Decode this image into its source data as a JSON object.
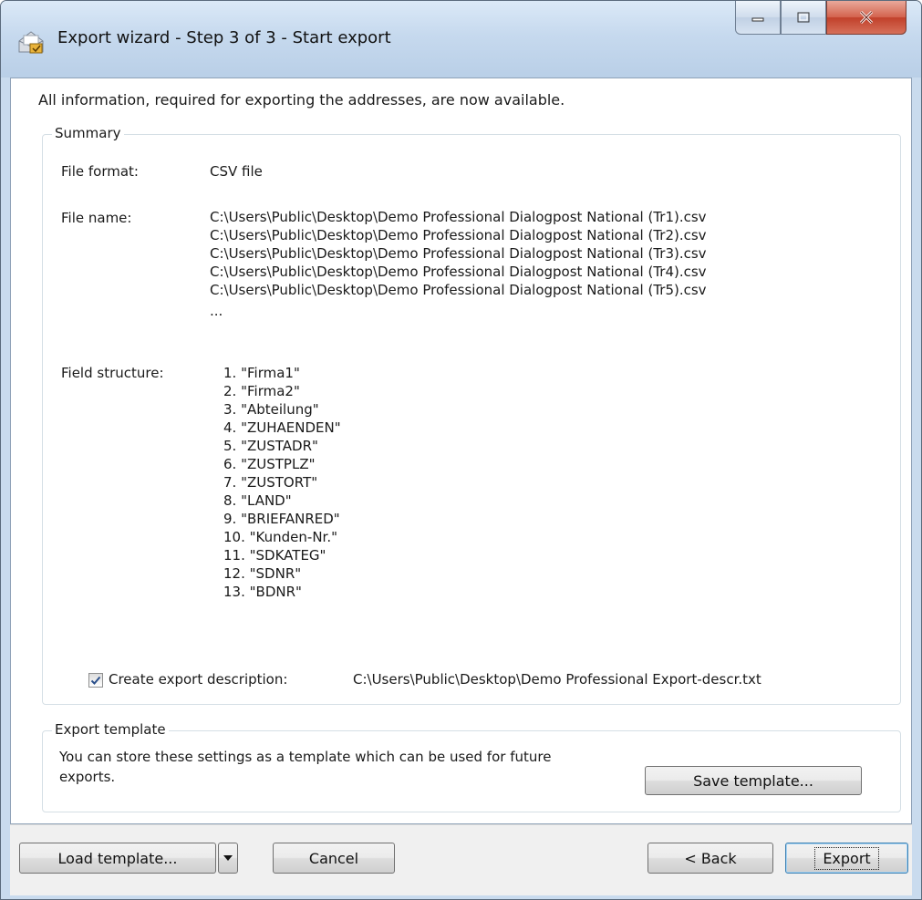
{
  "window": {
    "title": "Export wizard - Step 3 of 3 - Start export"
  },
  "intro_text": "All information, required for exporting the addresses, are now available.",
  "summary": {
    "legend": "Summary",
    "file_format_label": "File format:",
    "file_format_value": "CSV file",
    "file_name_label": "File name:",
    "file_names": [
      "C:\\Users\\Public\\Desktop\\Demo Professional Dialogpost National (Tr1).csv",
      "C:\\Users\\Public\\Desktop\\Demo Professional Dialogpost National (Tr2).csv",
      "C:\\Users\\Public\\Desktop\\Demo Professional Dialogpost National (Tr3).csv",
      "C:\\Users\\Public\\Desktop\\Demo Professional Dialogpost National (Tr4).csv",
      "C:\\Users\\Public\\Desktop\\Demo Professional Dialogpost National (Tr5).csv"
    ],
    "file_names_more": "...",
    "field_structure_label": "Field structure:",
    "fields": [
      {
        "num": "1.",
        "name": "\"Firma1\""
      },
      {
        "num": "2.",
        "name": "\"Firma2\""
      },
      {
        "num": "3.",
        "name": "\"Abteilung\""
      },
      {
        "num": "4.",
        "name": "\"ZUHAENDEN\""
      },
      {
        "num": "5.",
        "name": "\"ZUSTADR\""
      },
      {
        "num": "6.",
        "name": "\"ZUSTPLZ\""
      },
      {
        "num": "7.",
        "name": "\"ZUSTORT\""
      },
      {
        "num": "8.",
        "name": "\"LAND\""
      },
      {
        "num": "9.",
        "name": "\"BRIEFANRED\""
      },
      {
        "num": "10.",
        "name": "\"Kunden-Nr.\""
      },
      {
        "num": "11.",
        "name": "\"SDKATEG\""
      },
      {
        "num": "12.",
        "name": "\"SDNR\""
      },
      {
        "num": "13.",
        "name": "\"BDNR\""
      }
    ],
    "create_description_label": "Create export description:",
    "create_description_checked": true,
    "description_path": "C:\\Users\\Public\\Desktop\\Demo Professional Export-descr.txt"
  },
  "export_template": {
    "legend": "Export template",
    "text": "You can store these settings as a template which can be used for future exports.",
    "save_button": "Save template..."
  },
  "buttons": {
    "load_template": "Load template...",
    "cancel": "Cancel",
    "back": "< Back",
    "export": "Export"
  }
}
